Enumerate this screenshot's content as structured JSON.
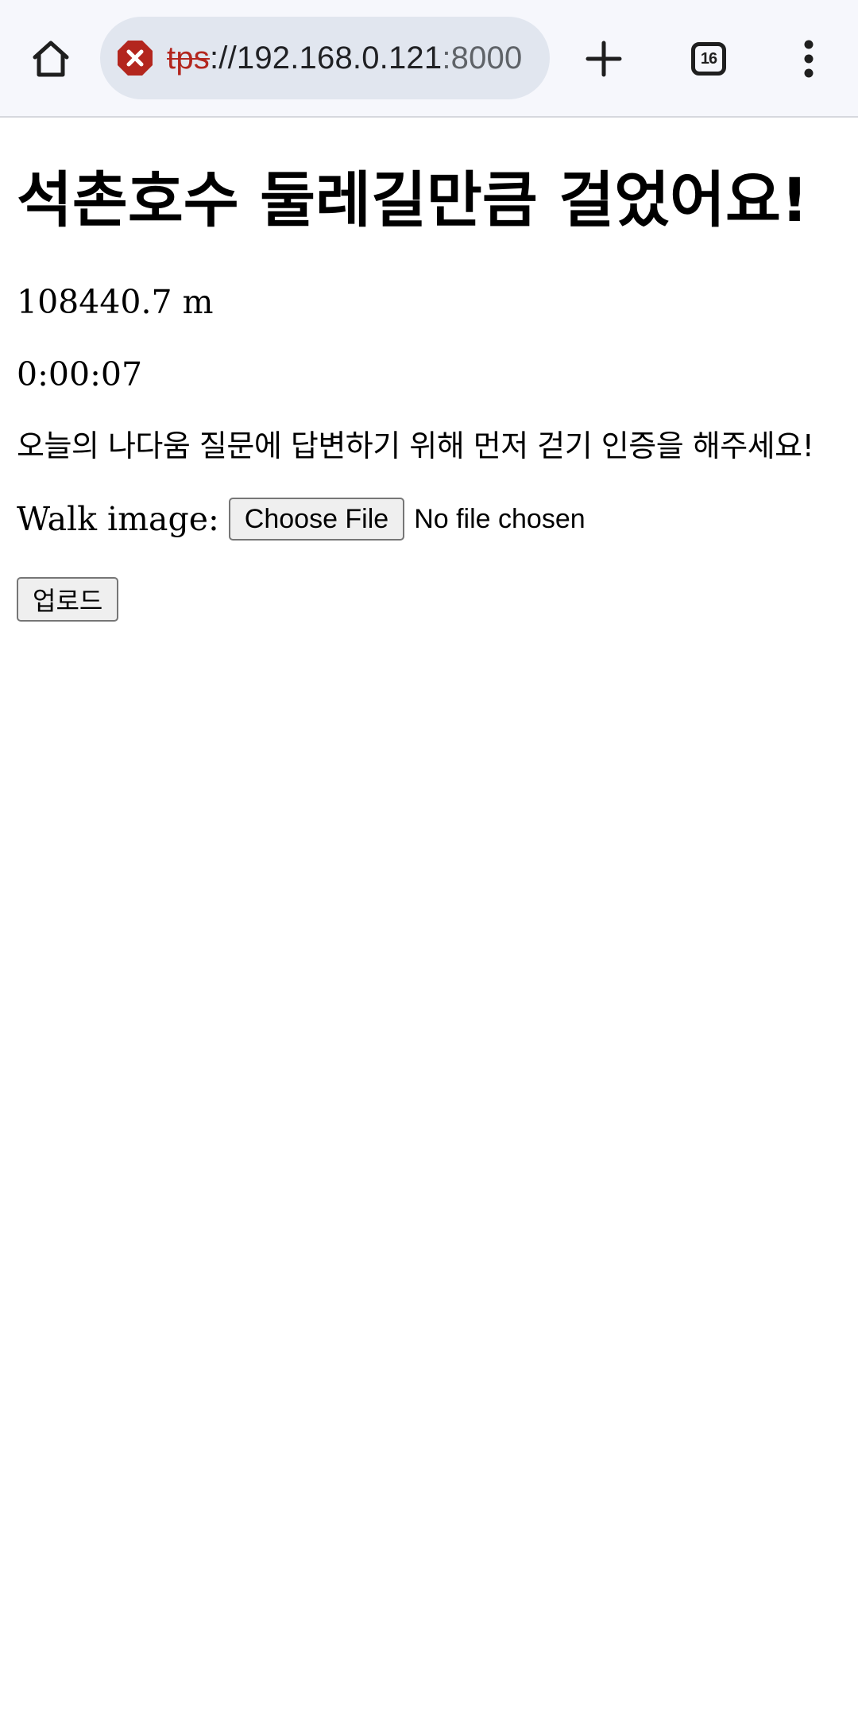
{
  "browser": {
    "url_scheme": "tps",
    "url_host": "://192.168.0.121",
    "url_port": ":8000",
    "tab_count": "16",
    "icons": {
      "home": "home-icon",
      "security": "not-secure-icon",
      "new_tab": "plus-icon",
      "tabs": "tab-switcher-icon",
      "menu": "more-vert-icon"
    },
    "colors": {
      "insecure_scheme": "#b3261e",
      "security_icon": "#b3261e"
    }
  },
  "page": {
    "title": "석촌호수 둘레길만큼 걸었어요!",
    "distance": "108440.7 m",
    "elapsed": "0:00:07",
    "prompt": "오늘의 나다움 질문에 답변하기 위해 먼저 걷기 인증을 해주세요!",
    "walk_label": "Walk image:",
    "choose_file_label": "Choose File",
    "no_file_text": "No file chosen",
    "upload_label": "업로드"
  }
}
